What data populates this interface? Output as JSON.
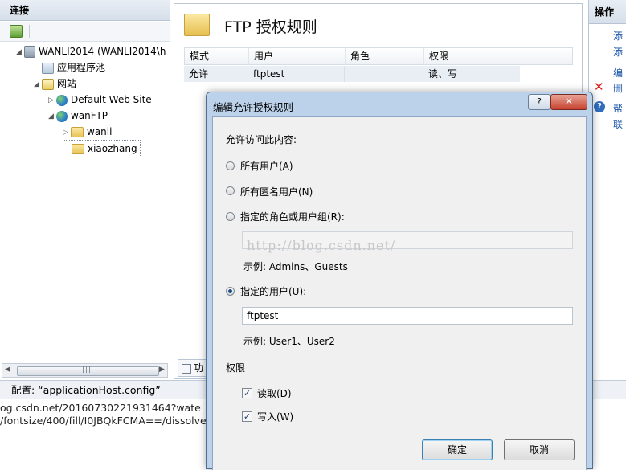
{
  "connections": {
    "header": "连接",
    "tree": [
      {
        "label": "WANLI2014 (WANLI2014\\h",
        "icon": "server-icon"
      },
      {
        "label": "应用程序池",
        "icon": "app-pool-icon"
      },
      {
        "label": "网站",
        "icon": "sites-icon"
      },
      {
        "label": "Default Web Site",
        "icon": "globe-icon"
      },
      {
        "label": "wanFTP",
        "icon": "globe-icon"
      },
      {
        "label": "wanli",
        "icon": "folder-icon"
      },
      {
        "label": "xiaozhang",
        "icon": "folder-icon"
      }
    ]
  },
  "main": {
    "title": "FTP 授权规则",
    "columns": [
      "模式",
      "用户",
      "角色",
      "权限"
    ],
    "rows": [
      {
        "mode": "允许",
        "user": "ftptest",
        "role": "",
        "perm": "读、写"
      }
    ],
    "bottom_tab": "功"
  },
  "actions": {
    "header": "操作",
    "items": [
      "添",
      "添",
      "编",
      "删",
      "帮",
      "联"
    ]
  },
  "status": {
    "config": "配置: “applicationHost.config”"
  },
  "overflow_text": [
    "og.csdn.net/20160730221931464?wate",
    "/fontsize/400/fill/I0JBQkFCMA==/dissolve"
  ],
  "dialog": {
    "title": "编辑允许授权规则",
    "help": "?",
    "close": "✕",
    "section_label": "允许访问此内容:",
    "options": {
      "all_users": "所有用户(A)",
      "anonymous": "所有匿名用户(N)",
      "roles": "指定的角色或用户组(R):",
      "users": "指定的用户(U):"
    },
    "roles_value": "",
    "roles_example": "示例: Admins、Guests",
    "users_value": "ftptest",
    "users_example": "示例: User1、User2",
    "permissions_label": "权限",
    "read": "读取(D)",
    "write": "写入(W)",
    "ok": "确定",
    "cancel": "取消",
    "watermark": "http://blog.csdn.net/"
  }
}
